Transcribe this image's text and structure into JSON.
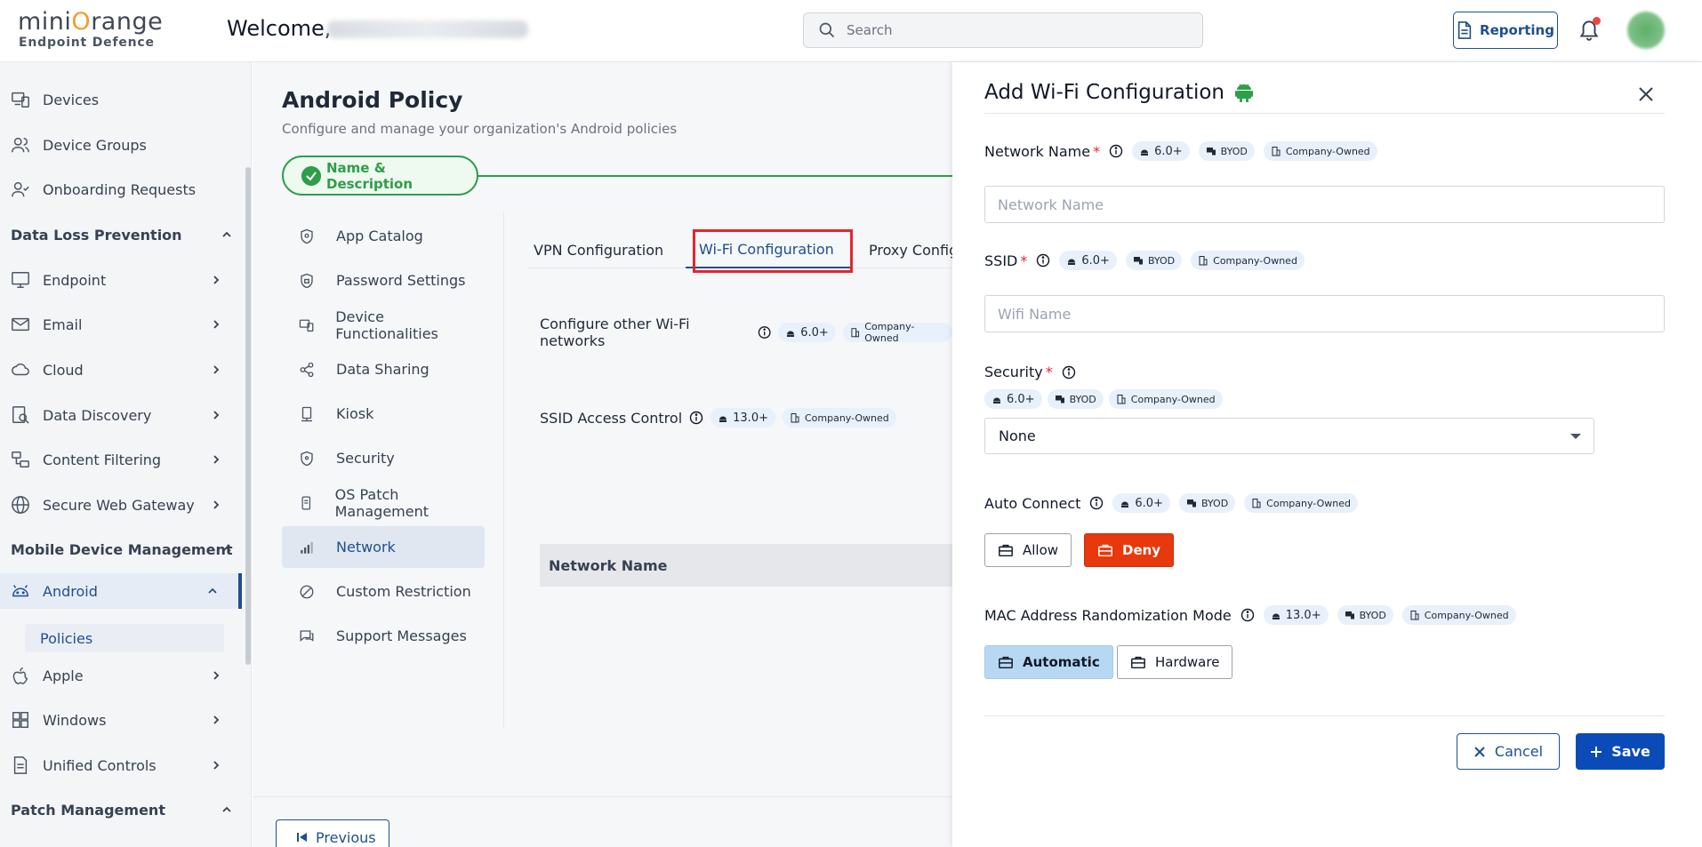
{
  "brand": {
    "logo_text_pre": "mini",
    "logo_text_o": "O",
    "logo_text_post": "range",
    "tagline": "Endpoint Defence"
  },
  "header": {
    "welcome": "Welcome,",
    "search_placeholder": "Search",
    "reporting_label": "Reporting"
  },
  "sidebar": {
    "items_top": [
      {
        "label": "Devices",
        "icon": "devices-icon"
      },
      {
        "label": "Device Groups",
        "icon": "users-icon"
      },
      {
        "label": "Onboarding Requests",
        "icon": "user-check-icon"
      }
    ],
    "section_dlp": "Data Loss Prevention",
    "dlp_items": [
      {
        "label": "Endpoint",
        "icon": "monitor-icon"
      },
      {
        "label": "Email",
        "icon": "mail-icon"
      },
      {
        "label": "Cloud",
        "icon": "cloud-icon"
      },
      {
        "label": "Data Discovery",
        "icon": "search-doc-icon"
      },
      {
        "label": "Content Filtering",
        "icon": "filter-icon"
      },
      {
        "label": "Secure Web Gateway",
        "icon": "globe-icon"
      }
    ],
    "section_mdm": "Mobile Device Management",
    "mdm_items": [
      {
        "label": "Android",
        "icon": "android-icon"
      },
      {
        "label": "Apple",
        "icon": "apple-icon"
      },
      {
        "label": "Windows",
        "icon": "windows-icon"
      },
      {
        "label": "Unified Controls",
        "icon": "doc-icon"
      }
    ],
    "android_sub": "Policies",
    "section_patch": "Patch Management"
  },
  "main": {
    "title": "Android Policy",
    "subtitle": "Configure and manage your organization's Android policies",
    "step_label": "Name & Description",
    "policy_items": [
      "App Catalog",
      "Password Settings",
      "Device Functionalities",
      "Data Sharing",
      "Kiosk",
      "Security",
      "OS Patch Management",
      "Network",
      "Custom Restriction",
      "Support Messages"
    ],
    "tabs": [
      "VPN Configuration",
      "Wi-Fi Configuration",
      "Proxy Config"
    ],
    "cfg_other": "Configure other Wi-Fi networks",
    "cfg_other_version": "6.0+",
    "cfg_other_ownership": "Company-Owned",
    "ssid_access": "SSID Access Control",
    "ssid_access_version": "13.0+",
    "ssid_access_ownership": "Company-Owned",
    "table_col": "Network Name",
    "prev_label": "Previous"
  },
  "panel": {
    "title": "Add Wi-Fi Configuration",
    "network_name_label": "Network Name",
    "network_name_placeholder": "Network Name",
    "ssid_label": "SSID",
    "ssid_placeholder": "Wifi Name",
    "security_label": "Security",
    "security_value": "None",
    "auto_connect_label": "Auto Connect",
    "allow_label": "Allow",
    "deny_label": "Deny",
    "mac_label": "MAC Address Randomization Mode",
    "automatic_label": "Automatic",
    "hardware_label": "Hardware",
    "badge_v6": "6.0+",
    "badge_v13": "13.0+",
    "badge_byod": "BYOD",
    "badge_company": "Company-Owned",
    "cancel_label": "Cancel",
    "save_label": "Save"
  },
  "colors": {
    "accent": "#1d4f91",
    "success": "#2e9e4a",
    "danger": "#e8380d",
    "primary_button": "#0a4bb8",
    "android_green": "#3ddc84",
    "highlight_red": "#e8232b"
  }
}
